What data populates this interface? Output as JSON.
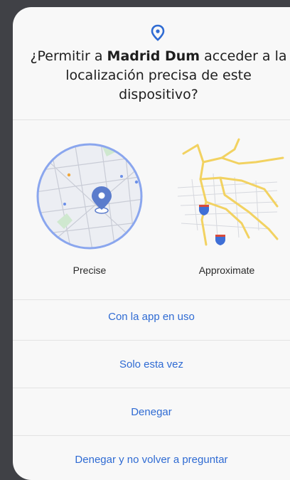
{
  "dialog": {
    "title_prefix": "¿Permitir a ",
    "app_name": "Madrid Dum",
    "title_suffix": " acceder a la localización precisa de este dispositivo?",
    "icon": "location-pin-icon",
    "accent_color": "#2f6bd3"
  },
  "maps": {
    "precise_label": "Precise",
    "approximate_label": "Approximate"
  },
  "options": [
    {
      "label": "Con la app en uso"
    },
    {
      "label": "Solo esta vez"
    },
    {
      "label": "Denegar"
    },
    {
      "label": "Denegar y no volver a preguntar"
    }
  ]
}
